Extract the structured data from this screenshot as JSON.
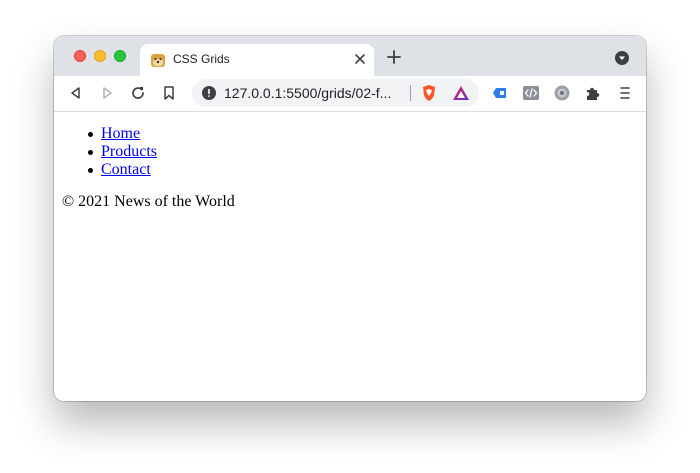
{
  "browser": {
    "tab": {
      "title": "CSS Grids"
    },
    "address_bar": {
      "url": "127.0.0.1:5500/grids/02-f..."
    }
  },
  "page": {
    "nav": [
      {
        "label": "Home"
      },
      {
        "label": "Products"
      },
      {
        "label": "Contact"
      }
    ],
    "footer": "© 2021 News of the World"
  },
  "colors": {
    "tabstrip": "#dee1e6",
    "link": "#0000ee",
    "traffic_red": "#ff5f57",
    "traffic_yellow": "#febc2e",
    "traffic_green": "#28c840"
  },
  "icons": [
    "back-icon",
    "forward-icon",
    "reload-icon",
    "bookmark-icon",
    "info-icon",
    "brave-shields-icon",
    "brave-rewards-icon",
    "extension-1-icon",
    "extension-2-icon",
    "extension-3-icon",
    "puzzle-icon",
    "menu-icon"
  ]
}
